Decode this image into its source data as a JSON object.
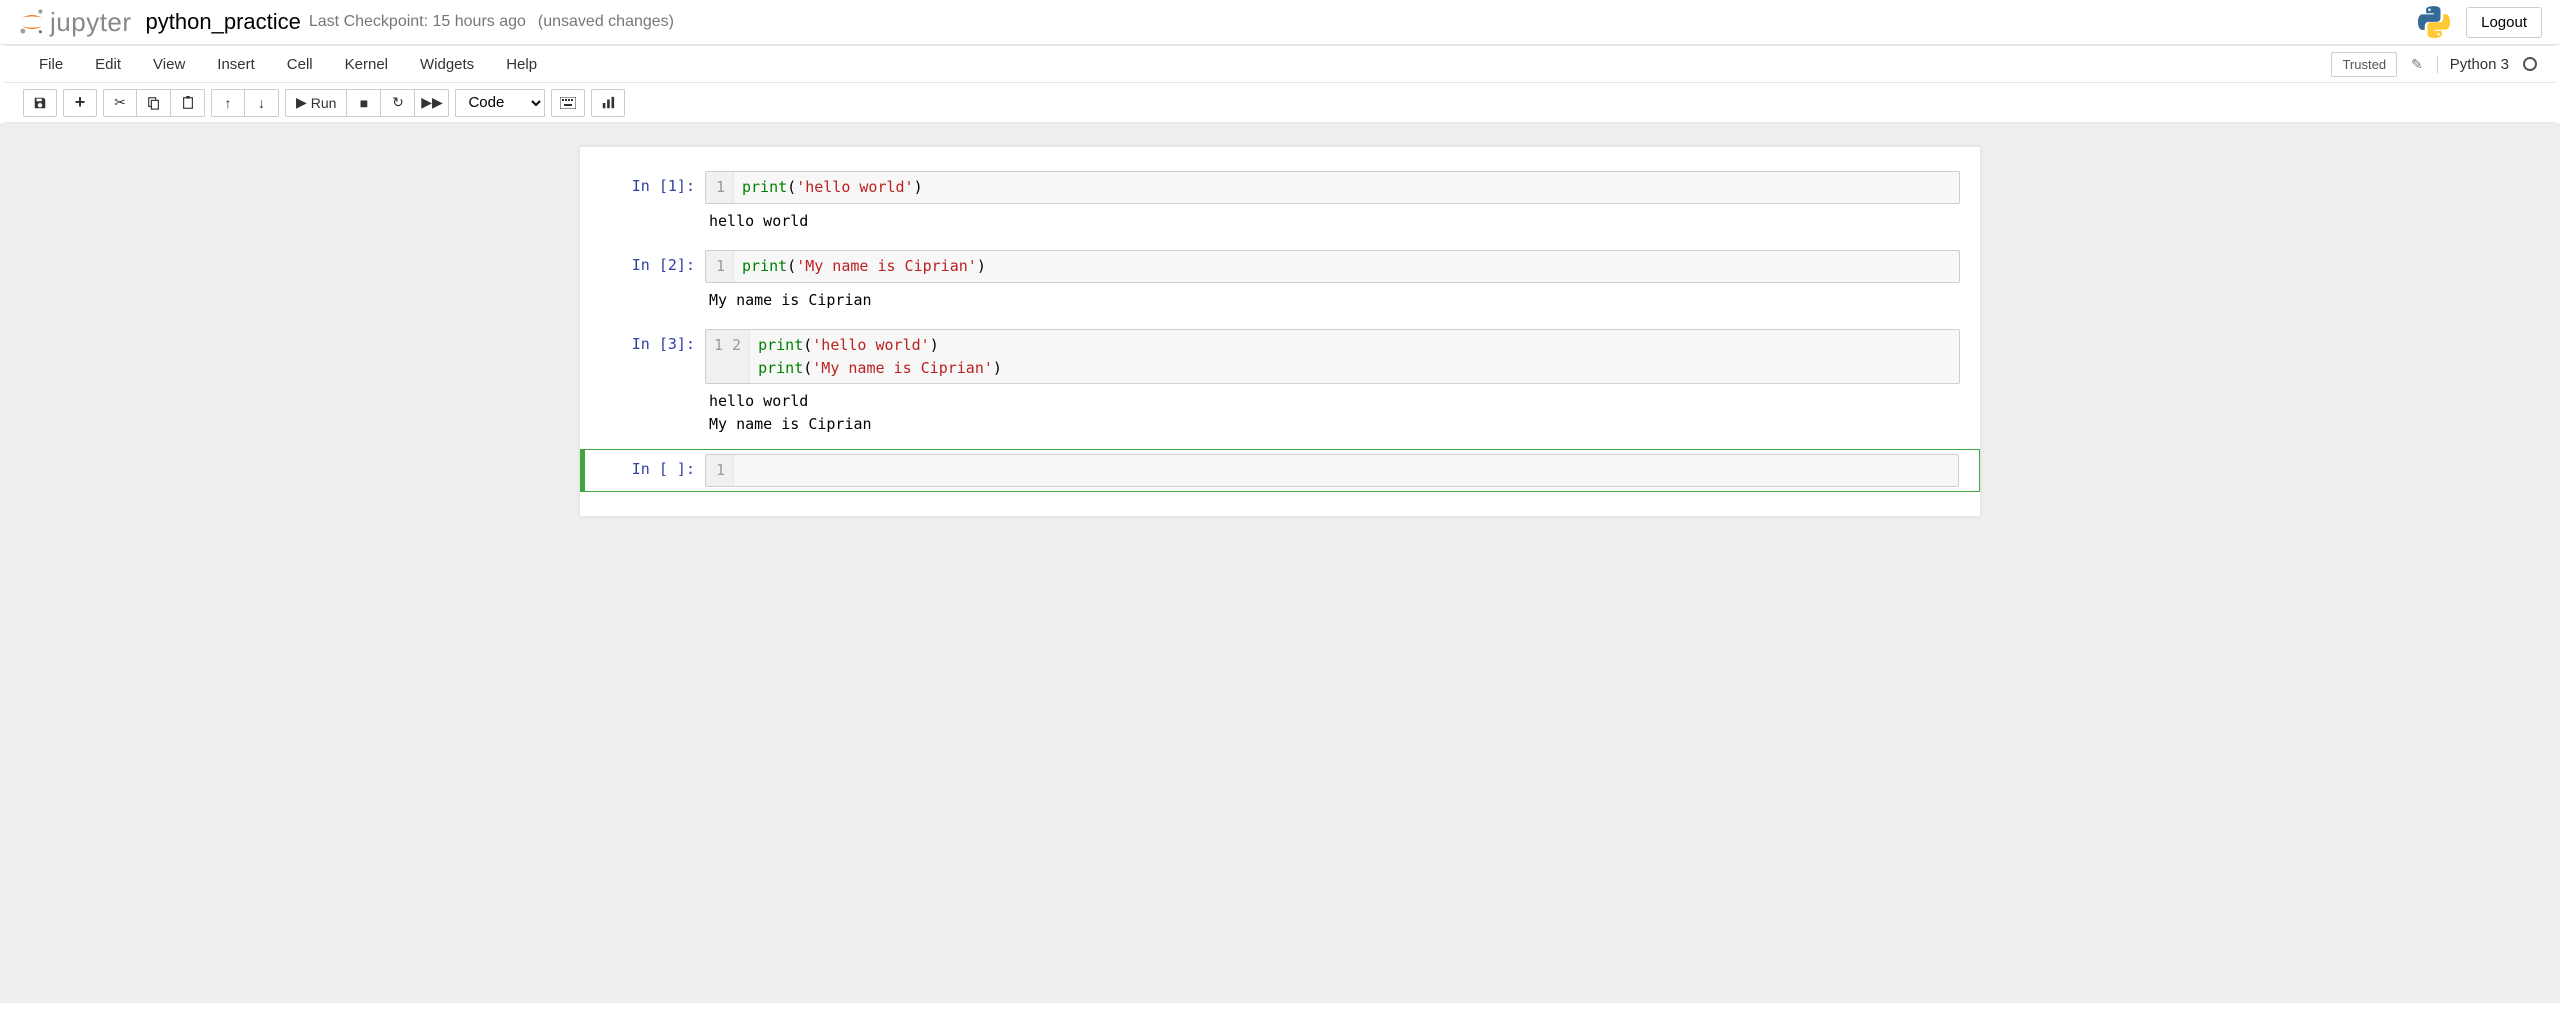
{
  "header": {
    "logo_text": "jupyter",
    "notebook_name": "python_practice",
    "checkpoint": "Last Checkpoint: 15 hours ago",
    "unsaved": "(unsaved changes)",
    "logout": "Logout"
  },
  "menubar": {
    "items": [
      "File",
      "Edit",
      "View",
      "Insert",
      "Cell",
      "Kernel",
      "Widgets",
      "Help"
    ],
    "trusted": "Trusted",
    "kernel": "Python 3"
  },
  "toolbar": {
    "run_label": "Run",
    "celltype": "Code"
  },
  "cells": [
    {
      "prompt": "In [1]:",
      "gutter": [
        "1"
      ],
      "code_segments": [
        [
          {
            "t": "print",
            "c": "cm-builtin"
          },
          {
            "t": "(",
            "c": ""
          },
          {
            "t": "'hello world'",
            "c": "cm-string"
          },
          {
            "t": ")",
            "c": ""
          }
        ]
      ],
      "output": "hello world",
      "selected": false
    },
    {
      "prompt": "In [2]:",
      "gutter": [
        "1"
      ],
      "code_segments": [
        [
          {
            "t": "print",
            "c": "cm-builtin"
          },
          {
            "t": "(",
            "c": ""
          },
          {
            "t": "'My name is Ciprian'",
            "c": "cm-string"
          },
          {
            "t": ")",
            "c": ""
          }
        ]
      ],
      "output": "My name is Ciprian",
      "selected": false
    },
    {
      "prompt": "In [3]:",
      "gutter": [
        "1",
        "2"
      ],
      "code_segments": [
        [
          {
            "t": "print",
            "c": "cm-builtin"
          },
          {
            "t": "(",
            "c": ""
          },
          {
            "t": "'hello world'",
            "c": "cm-string"
          },
          {
            "t": ")",
            "c": ""
          }
        ],
        [
          {
            "t": "print",
            "c": "cm-builtin"
          },
          {
            "t": "(",
            "c": ""
          },
          {
            "t": "'My name is Ciprian'",
            "c": "cm-string"
          },
          {
            "t": ")",
            "c": ""
          }
        ]
      ],
      "output": "hello world\nMy name is Ciprian",
      "selected": false
    },
    {
      "prompt": "In [ ]:",
      "gutter": [
        "1"
      ],
      "code_segments": [
        [
          {
            "t": "",
            "c": ""
          }
        ]
      ],
      "output": "",
      "selected": true
    }
  ]
}
